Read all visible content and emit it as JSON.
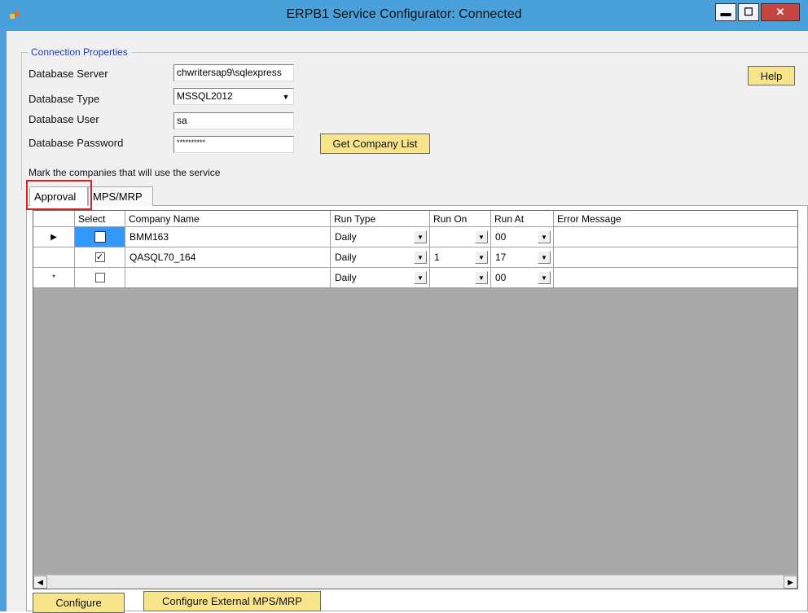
{
  "window": {
    "title": "ERPB1 Service Configurator: Connected"
  },
  "connection": {
    "legend": "Connection Properties",
    "server_label": "Database Server",
    "server_value": "chwritersap9\\sqlexpress",
    "type_label": "Database Type",
    "type_value": "MSSQL2012",
    "user_label": "Database User",
    "user_value": "sa",
    "password_label": "Database Password",
    "password_value": "**********",
    "get_company_list": "Get Company List",
    "help": "Help"
  },
  "mark_text": "Mark the companies that will use the service",
  "tabs": [
    {
      "label": "Approval",
      "active": true
    },
    {
      "label": "MPS/MRP",
      "active": false
    }
  ],
  "grid": {
    "columns": [
      "Select",
      "Company Name",
      "Run Type",
      "Run On",
      "Run At",
      "Error Message"
    ],
    "rows": [
      {
        "indicator": "▶",
        "checked": false,
        "name": "BMM163",
        "run_type": "Daily",
        "run_on": "",
        "run_at": "00",
        "error": ""
      },
      {
        "indicator": "",
        "checked": true,
        "name": "QASQL70_164",
        "run_type": "Daily",
        "run_on": "1",
        "run_at": "17",
        "error": ""
      },
      {
        "indicator": "*",
        "checked": false,
        "name": "",
        "run_type": "Daily",
        "run_on": "",
        "run_at": "00",
        "error": ""
      }
    ]
  },
  "buttons": {
    "configure": "Configure",
    "configure_external": "Configure External MPS/MRP"
  },
  "colors": {
    "titlebar": "#4aa0db",
    "button_yellow": "#f8e48a",
    "highlight_red": "#e02020",
    "selection_blue": "#3399ff"
  }
}
